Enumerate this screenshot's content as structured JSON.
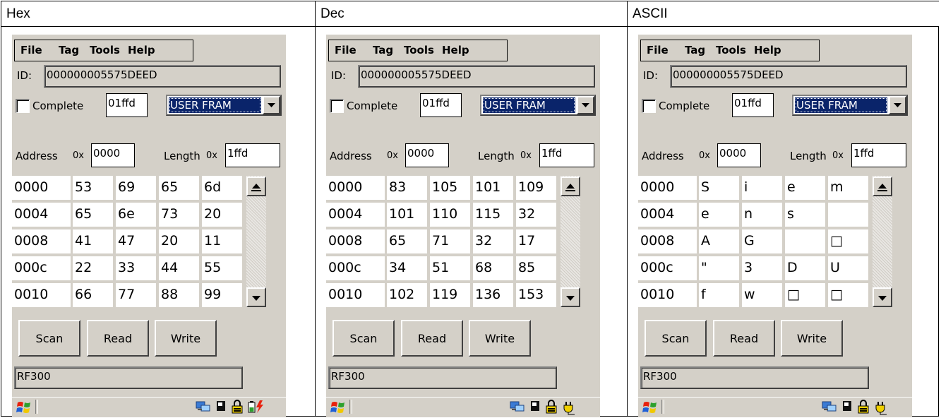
{
  "columns": [
    {
      "header": "Hex",
      "menu": [
        "File",
        "Tag",
        "Tools",
        "Help"
      ],
      "id_label": "ID:",
      "id_value": "000000005575DEED",
      "complete_label": "Complete",
      "complete_checked": false,
      "complete_value": "01ffd",
      "memory_selected": "USER FRAM",
      "address_label": "Address",
      "address_prefix": "0x",
      "address_value": "0000",
      "length_label": "Length",
      "length_prefix": "0x",
      "length_value": "1ffd",
      "rows": [
        {
          "addr": "0000",
          "cells": [
            "53",
            "69",
            "65",
            "6d"
          ]
        },
        {
          "addr": "0004",
          "cells": [
            "65",
            "6e",
            "73",
            "20"
          ]
        },
        {
          "addr": "0008",
          "cells": [
            "41",
            "47",
            "20",
            "11"
          ]
        },
        {
          "addr": "000c",
          "cells": [
            "22",
            "33",
            "44",
            "55"
          ]
        },
        {
          "addr": "0010",
          "cells": [
            "66",
            "77",
            "88",
            "99"
          ]
        }
      ],
      "buttons": {
        "scan": "Scan",
        "read": "Read",
        "write": "Write"
      },
      "status": "RF300",
      "tray_icons": [
        "network-icon",
        "card-icon",
        "lock-icon",
        "battery-charging-icon"
      ]
    },
    {
      "header": "Dec",
      "menu": [
        "File",
        "Tag",
        "Tools",
        "Help"
      ],
      "id_label": "ID:",
      "id_value": "000000005575DEED",
      "complete_label": "Complete",
      "complete_checked": false,
      "complete_value": "01ffd",
      "memory_selected": "USER FRAM",
      "address_label": "Address",
      "address_prefix": "0x",
      "address_value": "0000",
      "length_label": "Length",
      "length_prefix": "0x",
      "length_value": "1ffd",
      "rows": [
        {
          "addr": "0000",
          "cells": [
            "83",
            "105",
            "101",
            "109"
          ]
        },
        {
          "addr": "0004",
          "cells": [
            "101",
            "110",
            "115",
            "32"
          ]
        },
        {
          "addr": "0008",
          "cells": [
            "65",
            "71",
            "32",
            "17"
          ]
        },
        {
          "addr": "000c",
          "cells": [
            "34",
            "51",
            "68",
            "85"
          ]
        },
        {
          "addr": "0010",
          "cells": [
            "102",
            "119",
            "136",
            "153"
          ]
        }
      ],
      "buttons": {
        "scan": "Scan",
        "read": "Read",
        "write": "Write"
      },
      "status": "RF300",
      "tray_icons": [
        "network-icon",
        "card-icon",
        "lock-icon",
        "power-plug-icon"
      ]
    },
    {
      "header": "ASCII",
      "menu": [
        "File",
        "Tag",
        "Tools",
        "Help"
      ],
      "id_label": "ID:",
      "id_value": "000000005575DEED",
      "complete_label": "Complete",
      "complete_checked": false,
      "complete_value": "01ffd",
      "memory_selected": "USER FRAM",
      "address_label": "Address",
      "address_prefix": "0x",
      "address_value": "0000",
      "length_label": "Length",
      "length_prefix": "0x",
      "length_value": "1ffd",
      "rows": [
        {
          "addr": "0000",
          "cells": [
            "S",
            "i",
            "e",
            "m"
          ]
        },
        {
          "addr": "0004",
          "cells": [
            "e",
            "n",
            "s",
            ""
          ]
        },
        {
          "addr": "0008",
          "cells": [
            "A",
            "G",
            "",
            "□"
          ]
        },
        {
          "addr": "000c",
          "cells": [
            "\"",
            "3",
            "D",
            "U"
          ]
        },
        {
          "addr": "0010",
          "cells": [
            "f",
            "w",
            "□",
            "□"
          ]
        }
      ],
      "buttons": {
        "scan": "Scan",
        "read": "Read",
        "write": "Write"
      },
      "status": "RF300",
      "tray_icons": [
        "network-icon",
        "card-icon",
        "lock-icon",
        "power-plug-icon"
      ]
    }
  ],
  "colors": {
    "window_bg": "#d4d0c8",
    "selection_bg": "#0a246a",
    "selection_fg": "#ffffff"
  }
}
